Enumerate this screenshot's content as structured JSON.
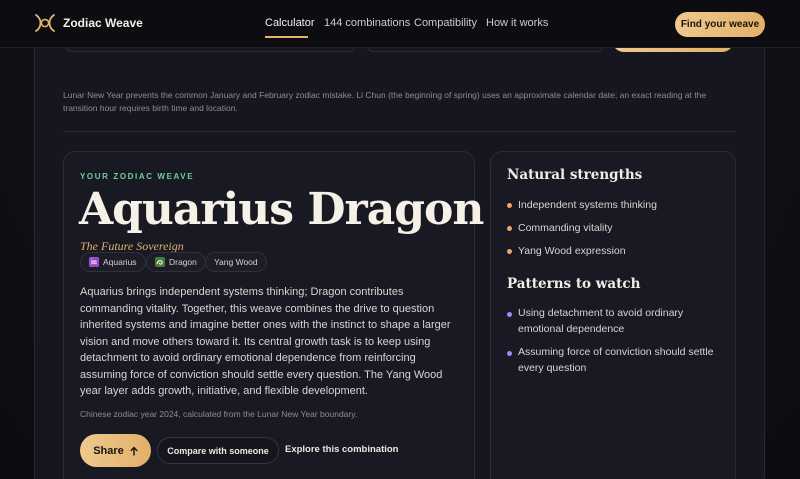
{
  "header": {
    "brand": "Zodiac Weave",
    "nav": [
      "Calculator",
      "144 combinations",
      "Compatibility",
      "How it works"
    ],
    "active_nav": "Calculator",
    "cta_label": "Find your weave"
  },
  "note": "Lunar New Year prevents the common January and February zodiac mistake. Li Chun (the beginning of spring) uses an approximate calendar date; an exact reading at the transition hour requires birth time and location.",
  "result": {
    "eyebrow": "YOUR ZODIAC WEAVE",
    "title": "Aquarius Dragon",
    "subtitle": "The Future Sovereign",
    "chips": [
      {
        "label": "Aquarius",
        "icon": "aquarius-icon",
        "color": "#8b5cf6"
      },
      {
        "label": "Dragon",
        "icon": "dragon-icon",
        "color": "#4b7a3a"
      },
      {
        "label": "Yang Wood",
        "icon": "",
        "color": ""
      }
    ],
    "description": "Aquarius brings independent systems thinking; Dragon contributes commanding vitality. Together, this weave combines the drive to question inherited systems and imagine better ones with the instinct to shape a larger vision and move others toward it. Its central growth task is to keep using detachment to avoid ordinary emotional dependence from reinforcing assuming force of conviction should settle every question. The Yang Wood year layer adds growth, initiative, and flexible development.",
    "year_note": "Chinese zodiac year 2024, calculated from the Lunar New Year boundary.",
    "share_label": "Share",
    "compare_label": "Compare with someone",
    "explore_label": "Explore this combination"
  },
  "side": {
    "strengths_title": "Natural strengths",
    "strengths": [
      "Independent systems thinking",
      "Commanding vitality",
      "Yang Wood expression"
    ],
    "patterns_title": "Patterns to watch",
    "patterns": [
      "Using detachment to avoid ordinary emotional dependence",
      "Assuming force of conviction should settle every question"
    ]
  },
  "colors": {
    "accent_gold": "#e7b56a",
    "eyebrow_green": "#6fcf9a",
    "strength_bullet": "#e7a869",
    "pattern_bullet": "#9b8cf0"
  }
}
